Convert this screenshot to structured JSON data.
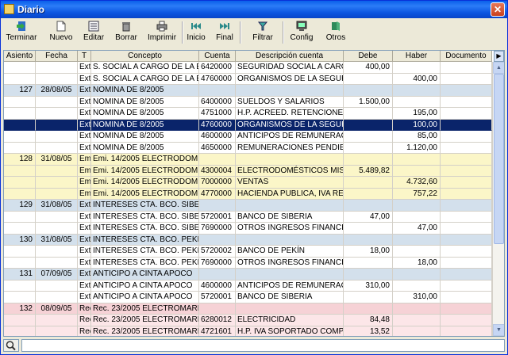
{
  "window": {
    "title": "Diario",
    "close_label": "✕"
  },
  "toolbar": [
    {
      "label": "Terminar",
      "icon": "exit-icon"
    },
    {
      "label": "Nuevo",
      "icon": "new-document-icon"
    },
    {
      "label": "Editar",
      "icon": "edit-icon"
    },
    {
      "label": "Borrar",
      "icon": "trash-icon"
    },
    {
      "label": "Imprimir",
      "icon": "printer-icon"
    },
    {
      "label": "Inicio",
      "icon": "first-icon"
    },
    {
      "label": "Final",
      "icon": "last-icon"
    },
    {
      "label": "Filtrar",
      "icon": "filter-icon"
    },
    {
      "label": "Config",
      "icon": "config-icon"
    },
    {
      "label": "Otros",
      "icon": "others-icon"
    }
  ],
  "columns": [
    "Asiento",
    "Fecha",
    "T",
    "Concepto",
    "Cuenta",
    "Descripción cuenta",
    "Debe",
    "Haber",
    "Documento"
  ],
  "rows": [
    {
      "style": "",
      "cells": [
        "",
        "",
        "Ext",
        "S. SOCIAL A CARGO DE LA EMPI",
        "6420000",
        "SEGURIDAD SOCIAL A CARGO D",
        "400,00",
        "",
        ""
      ]
    },
    {
      "style": "",
      "cells": [
        "",
        "",
        "Ext",
        "S. SOCIAL A CARGO DE LA EMPI",
        "4760000",
        "ORGANISMOS DE LA SEGURIDA",
        "",
        "400,00",
        ""
      ]
    },
    {
      "style": "h-header",
      "cells": [
        "127",
        "28/08/05",
        "Ext",
        "NOMINA DE 8/2005",
        "",
        "",
        "",
        "",
        ""
      ]
    },
    {
      "style": "",
      "cells": [
        "",
        "",
        "Ext",
        "NOMINA DE 8/2005",
        "6400000",
        "SUELDOS Y SALARIOS",
        "1.500,00",
        "",
        ""
      ]
    },
    {
      "style": "",
      "cells": [
        "",
        "",
        "Ext",
        "NOMINA DE 8/2005",
        "4751000",
        "H.P. ACREED. RETENCIONES IR",
        "",
        "195,00",
        ""
      ]
    },
    {
      "style": "selected",
      "cells": [
        "",
        "",
        "Ext",
        "NOMINA DE 8/2005",
        "4760000",
        "ORGANISMOS DE LA SEGURIDA",
        "",
        "100,00",
        ""
      ]
    },
    {
      "style": "",
      "cells": [
        "",
        "",
        "Ext",
        "NOMINA DE 8/2005",
        "4600000",
        "ANTICIPOS DE REMUNERACION",
        "",
        "85,00",
        ""
      ]
    },
    {
      "style": "",
      "cells": [
        "",
        "",
        "Ext",
        "NOMINA DE 8/2005",
        "4650000",
        "REMUNERACIONES PENDIENTE",
        "",
        "1.120,00",
        ""
      ]
    },
    {
      "style": "h-yellow",
      "cells": [
        "128",
        "31/08/05",
        "Emi",
        "Emi. 14/2005 ELECTRODOMÉST",
        "",
        "",
        "",
        "",
        ""
      ]
    },
    {
      "style": "h-yellow",
      "cells": [
        "",
        "",
        "Emi",
        "Emi. 14/2005 ELECTRODOMÉST",
        "4300004",
        "ELECTRODOMÉSTICOS MISLATA",
        "5.489,82",
        "",
        ""
      ]
    },
    {
      "style": "h-yellow",
      "cells": [
        "",
        "",
        "Emi",
        "Emi. 14/2005 ELECTRODOMÉST",
        "7000000",
        "VENTAS",
        "",
        "4.732,60",
        ""
      ]
    },
    {
      "style": "h-yellow",
      "cells": [
        "",
        "",
        "Emi",
        "Emi. 14/2005 ELECTRODOMÉST",
        "4770000",
        "HACIENDA PUBLICA, IVA REPER",
        "",
        "757,22",
        ""
      ]
    },
    {
      "style": "h-header",
      "cells": [
        "129",
        "31/08/05",
        "Ext",
        "INTERESES CTA. BCO. SIBERIA",
        "",
        "",
        "",
        "",
        ""
      ]
    },
    {
      "style": "",
      "cells": [
        "",
        "",
        "Ext",
        "INTERESES CTA. BCO. SIBERIA",
        "5720001",
        "BANCO DE SIBERIA",
        "47,00",
        "",
        ""
      ]
    },
    {
      "style": "",
      "cells": [
        "",
        "",
        "Ext",
        "INTERESES CTA. BCO. SIBERIA",
        "7690000",
        "OTROS INGRESOS FINANCIERO",
        "",
        "47,00",
        ""
      ]
    },
    {
      "style": "h-header",
      "cells": [
        "130",
        "31/08/05",
        "Ext",
        "INTERESES CTA. BCO. PEKIN",
        "",
        "",
        "",
        "",
        ""
      ]
    },
    {
      "style": "",
      "cells": [
        "",
        "",
        "Ext",
        "INTERESES CTA. BCO. PEKIN",
        "5720002",
        "BANCO DE PEKÍN",
        "18,00",
        "",
        ""
      ]
    },
    {
      "style": "",
      "cells": [
        "",
        "",
        "Ext",
        "INTERESES CTA. BCO. PEKIN",
        "7690000",
        "OTROS INGRESOS FINANCIERO",
        "",
        "18,00",
        ""
      ]
    },
    {
      "style": "h-header",
      "cells": [
        "131",
        "07/09/05",
        "Ext",
        "ANTICIPO A CINTA APOCO",
        "",
        "",
        "",
        "",
        ""
      ]
    },
    {
      "style": "",
      "cells": [
        "",
        "",
        "Ext",
        "ANTICIPO A CINTA APOCO",
        "4600000",
        "ANTICIPOS DE REMUNERACION",
        "310,00",
        "",
        ""
      ]
    },
    {
      "style": "",
      "cells": [
        "",
        "",
        "Ext",
        "ANTICIPO A CINTA APOCO",
        "5720001",
        "BANCO DE SIBERIA",
        "",
        "310,00",
        ""
      ]
    },
    {
      "style": "h-pink",
      "cells": [
        "132",
        "08/09/05",
        "Rec",
        "Rec. 23/2005 ELECTROMARKINO",
        "",
        "",
        "",
        "",
        ""
      ]
    },
    {
      "style": "h-pinkl",
      "cells": [
        "",
        "",
        "Rec",
        "Rec. 23/2005 ELECTROMARKINO",
        "6280012",
        "ELECTRICIDAD",
        "84,48",
        "",
        ""
      ]
    },
    {
      "style": "h-pinkl",
      "cells": [
        "",
        "",
        "Rec",
        "Rec. 23/2005 ELECTROMARKINO",
        "4721601",
        "H.P. IVA SOPORTADO COMPRAS",
        "13,52",
        "",
        ""
      ]
    }
  ],
  "search": {
    "icon": "search-icon",
    "value": ""
  }
}
